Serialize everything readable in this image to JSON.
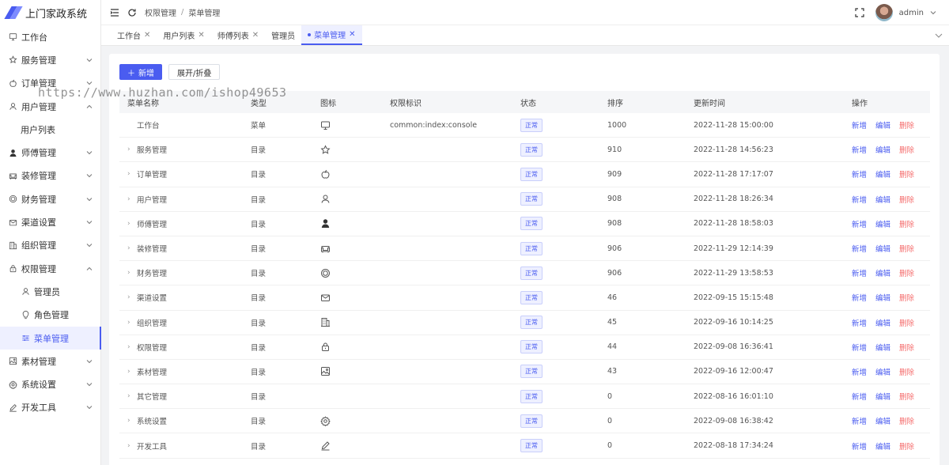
{
  "app": {
    "title": "上门家政系统"
  },
  "sidebar": {
    "items": [
      {
        "label": "工作台",
        "icon": "monitor-icon"
      },
      {
        "label": "服务管理",
        "icon": "star-icon"
      },
      {
        "label": "订单管理",
        "icon": "apple-icon"
      },
      {
        "label": "用户管理",
        "icon": "user-icon"
      },
      {
        "label": "用户列表"
      },
      {
        "label": "师傅管理",
        "icon": "user-filled-icon"
      },
      {
        "label": "装修管理",
        "icon": "sofa-icon"
      },
      {
        "label": "财务管理",
        "icon": "coin-icon"
      },
      {
        "label": "渠道设置",
        "icon": "message-icon"
      },
      {
        "label": "组织管理",
        "icon": "office-icon"
      },
      {
        "label": "权限管理",
        "icon": "lock-icon"
      },
      {
        "label": "管理员",
        "icon": "user-icon"
      },
      {
        "label": "角色管理",
        "icon": "bulb-icon"
      },
      {
        "label": "菜单管理",
        "icon": "operation-icon"
      },
      {
        "label": "素材管理",
        "icon": "picture-icon"
      },
      {
        "label": "系统设置",
        "icon": "gear-icon"
      },
      {
        "label": "开发工具",
        "icon": "edit-pen-icon"
      }
    ]
  },
  "header": {
    "breadcrumb": [
      "权限管理",
      "菜单管理"
    ],
    "separator": "/",
    "username": "admin"
  },
  "tabs": [
    {
      "label": "工作台"
    },
    {
      "label": "用户列表"
    },
    {
      "label": "师傅列表"
    },
    {
      "label": "管理员"
    },
    {
      "label": "菜单管理",
      "active": true
    }
  ],
  "toolbar": {
    "add_label": "新增",
    "toggle_label": "展开/折叠"
  },
  "table": {
    "columns": [
      "菜单名称",
      "类型",
      "图标",
      "权限标识",
      "状态",
      "排序",
      "更新时间",
      "操作"
    ],
    "rows": [
      {
        "name": "工作台",
        "type": "菜单",
        "icon": "monitor-icon",
        "perm": "common:index:console",
        "status": "正常",
        "order": "1000",
        "time": "2022-11-28 15:00:00",
        "expandable": false
      },
      {
        "name": "服务管理",
        "type": "目录",
        "icon": "star-icon",
        "perm": "",
        "status": "正常",
        "order": "910",
        "time": "2022-11-28 14:56:23",
        "expandable": true
      },
      {
        "name": "订单管理",
        "type": "目录",
        "icon": "apple-icon",
        "perm": "",
        "status": "正常",
        "order": "909",
        "time": "2022-11-28 17:17:07",
        "expandable": true
      },
      {
        "name": "用户管理",
        "type": "目录",
        "icon": "user-icon",
        "perm": "",
        "status": "正常",
        "order": "908",
        "time": "2022-11-28 18:26:34",
        "expandable": true
      },
      {
        "name": "师傅管理",
        "type": "目录",
        "icon": "user-filled-icon",
        "perm": "",
        "status": "正常",
        "order": "908",
        "time": "2022-11-28 18:58:03",
        "expandable": true
      },
      {
        "name": "装修管理",
        "type": "目录",
        "icon": "sofa-icon",
        "perm": "",
        "status": "正常",
        "order": "906",
        "time": "2022-11-29 12:14:39",
        "expandable": true
      },
      {
        "name": "财务管理",
        "type": "目录",
        "icon": "coin-icon",
        "perm": "",
        "status": "正常",
        "order": "906",
        "time": "2022-11-29 13:58:53",
        "expandable": true
      },
      {
        "name": "渠道设置",
        "type": "目录",
        "icon": "message-icon",
        "perm": "",
        "status": "正常",
        "order": "46",
        "time": "2022-09-15 15:15:48",
        "expandable": true
      },
      {
        "name": "组织管理",
        "type": "目录",
        "icon": "office-icon",
        "perm": "",
        "status": "正常",
        "order": "45",
        "time": "2022-09-16 10:14:25",
        "expandable": true
      },
      {
        "name": "权限管理",
        "type": "目录",
        "icon": "lock-icon",
        "perm": "",
        "status": "正常",
        "order": "44",
        "time": "2022-09-08 16:36:41",
        "expandable": true
      },
      {
        "name": "素材管理",
        "type": "目录",
        "icon": "picture-icon",
        "perm": "",
        "status": "正常",
        "order": "43",
        "time": "2022-09-16 12:00:47",
        "expandable": true
      },
      {
        "name": "其它管理",
        "type": "目录",
        "icon": "",
        "perm": "",
        "status": "正常",
        "order": "0",
        "time": "2022-08-16 16:01:10",
        "expandable": true
      },
      {
        "name": "系统设置",
        "type": "目录",
        "icon": "gear-icon",
        "perm": "",
        "status": "正常",
        "order": "0",
        "time": "2022-09-08 16:38:42",
        "expandable": true
      },
      {
        "name": "开发工具",
        "type": "目录",
        "icon": "edit-pen-icon",
        "perm": "",
        "status": "正常",
        "order": "0",
        "time": "2022-08-18 17:34:24",
        "expandable": true
      }
    ],
    "ops": {
      "add": "新增",
      "edit": "编辑",
      "del": "删除"
    }
  },
  "watermark": "https://www.huzhan.com/ishop49653",
  "colors": {
    "accent": "#4a5cf0",
    "danger": "#f56c6c"
  }
}
